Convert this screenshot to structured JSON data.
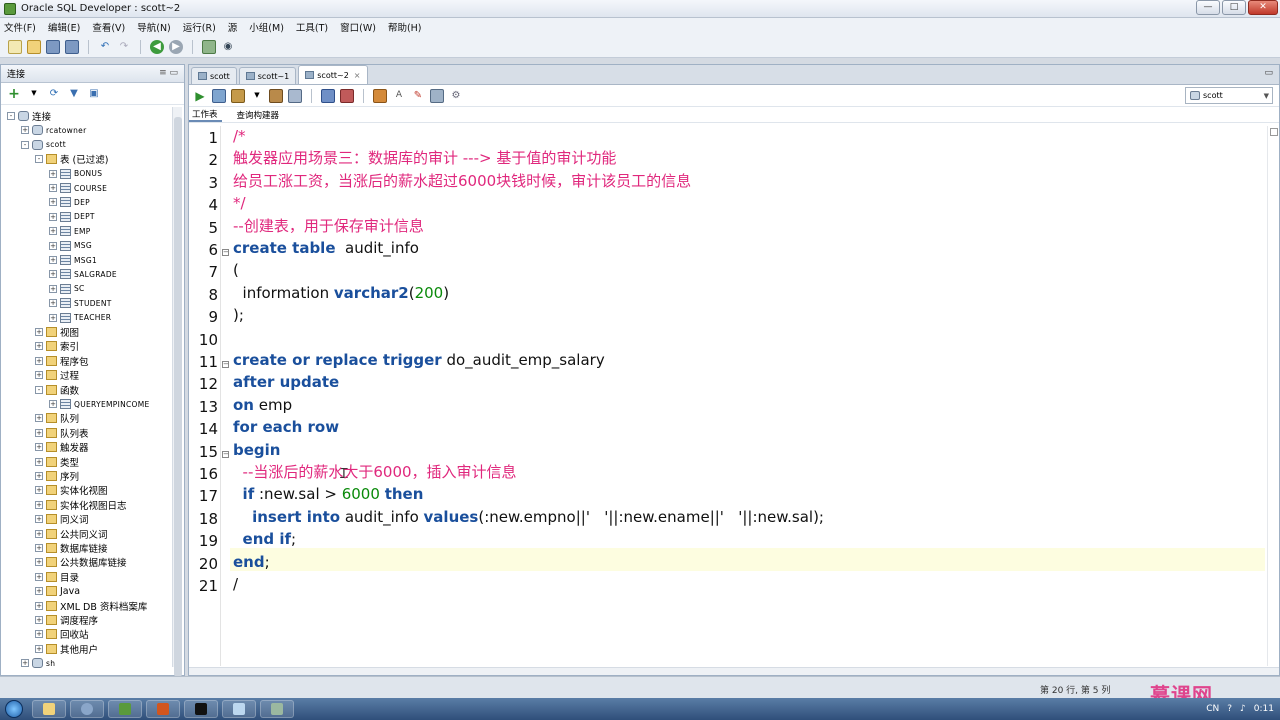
{
  "window": {
    "title": "Oracle SQL Developer : scott~2"
  },
  "menu": [
    "文件(F)",
    "编辑(E)",
    "查看(V)",
    "导航(N)",
    "运行(R)",
    "源",
    "小组(M)",
    "工具(T)",
    "窗口(W)",
    "帮助(H)"
  ],
  "left_panel": {
    "header": "连接",
    "tree": [
      {
        "label": "连接",
        "level": 0,
        "exp": "-",
        "icon": "db"
      },
      {
        "label": "rcatowner",
        "level": 1,
        "exp": "+",
        "icon": "db",
        "tiny": true
      },
      {
        "label": "scott",
        "level": 1,
        "exp": "-",
        "icon": "db",
        "tiny": true
      },
      {
        "label": "表 (已过滤)",
        "level": 2,
        "exp": "-",
        "icon": "folder"
      },
      {
        "label": "BONUS",
        "level": 3,
        "exp": "+",
        "icon": "table",
        "tiny": true
      },
      {
        "label": "COURSE",
        "level": 3,
        "exp": "+",
        "icon": "table",
        "tiny": true
      },
      {
        "label": "DEP",
        "level": 3,
        "exp": "+",
        "icon": "table",
        "tiny": true
      },
      {
        "label": "DEPT",
        "level": 3,
        "exp": "+",
        "icon": "table",
        "tiny": true
      },
      {
        "label": "EMP",
        "level": 3,
        "exp": "+",
        "icon": "table",
        "tiny": true
      },
      {
        "label": "MSG",
        "level": 3,
        "exp": "+",
        "icon": "table",
        "tiny": true
      },
      {
        "label": "MSG1",
        "level": 3,
        "exp": "+",
        "icon": "table",
        "tiny": true
      },
      {
        "label": "SALGRADE",
        "level": 3,
        "exp": "+",
        "icon": "table",
        "tiny": true
      },
      {
        "label": "SC",
        "level": 3,
        "exp": "+",
        "icon": "table",
        "tiny": true
      },
      {
        "label": "STUDENT",
        "level": 3,
        "exp": "+",
        "icon": "table",
        "tiny": true
      },
      {
        "label": "TEACHER",
        "level": 3,
        "exp": "+",
        "icon": "table",
        "tiny": true
      },
      {
        "label": "视图",
        "level": 2,
        "exp": "+",
        "icon": "folder"
      },
      {
        "label": "索引",
        "level": 2,
        "exp": "+",
        "icon": "folder"
      },
      {
        "label": "程序包",
        "level": 2,
        "exp": "+",
        "icon": "folder"
      },
      {
        "label": "过程",
        "level": 2,
        "exp": "+",
        "icon": "folder"
      },
      {
        "label": "函数",
        "level": 2,
        "exp": "-",
        "icon": "folder"
      },
      {
        "label": "QUERYEMPINCOME",
        "level": 3,
        "exp": "+",
        "icon": "table",
        "tiny": true
      },
      {
        "label": "队列",
        "level": 2,
        "exp": "+",
        "icon": "folder"
      },
      {
        "label": "队列表",
        "level": 2,
        "exp": "+",
        "icon": "folder"
      },
      {
        "label": "触发器",
        "level": 2,
        "exp": "+",
        "icon": "folder"
      },
      {
        "label": "类型",
        "level": 2,
        "exp": "+",
        "icon": "folder"
      },
      {
        "label": "序列",
        "level": 2,
        "exp": "+",
        "icon": "folder"
      },
      {
        "label": "实体化视图",
        "level": 2,
        "exp": "+",
        "icon": "folder"
      },
      {
        "label": "实体化视图日志",
        "level": 2,
        "exp": "+",
        "icon": "folder"
      },
      {
        "label": "同义词",
        "level": 2,
        "exp": "+",
        "icon": "folder"
      },
      {
        "label": "公共同义词",
        "level": 2,
        "exp": "+",
        "icon": "folder"
      },
      {
        "label": "数据库链接",
        "level": 2,
        "exp": "+",
        "icon": "folder"
      },
      {
        "label": "公共数据库链接",
        "level": 2,
        "exp": "+",
        "icon": "folder"
      },
      {
        "label": "目录",
        "level": 2,
        "exp": "+",
        "icon": "folder"
      },
      {
        "label": "Java",
        "level": 2,
        "exp": "+",
        "icon": "folder"
      },
      {
        "label": "XML DB 资料档案库",
        "level": 2,
        "exp": "+",
        "icon": "folder"
      },
      {
        "label": "调度程序",
        "level": 2,
        "exp": "+",
        "icon": "folder"
      },
      {
        "label": "回收站",
        "level": 2,
        "exp": "+",
        "icon": "folder"
      },
      {
        "label": "其他用户",
        "level": 2,
        "exp": "+",
        "icon": "folder"
      },
      {
        "label": "sh",
        "level": 1,
        "exp": "+",
        "icon": "db",
        "tiny": true
      }
    ]
  },
  "editor": {
    "tabs": [
      {
        "label": "scott",
        "active": false
      },
      {
        "label": "scott~1",
        "active": false
      },
      {
        "label": "scott~2",
        "active": true
      }
    ],
    "connection": "scott",
    "subtabs": [
      "工作表",
      "查询构建器"
    ],
    "lines": [
      [
        {
          "t": "/*",
          "c": "cmt"
        }
      ],
      [
        {
          "t": "触发器应用场景三：数据库的审计 ---> 基于值的审计功能",
          "c": "cmt"
        }
      ],
      [
        {
          "t": "给员工涨工资，当涨后的薪水超过6000块钱时候，审计该员工的信息",
          "c": "cmt"
        }
      ],
      [
        {
          "t": "*/",
          "c": "cmt"
        }
      ],
      [
        {
          "t": "--创建表，用于保存审计信息",
          "c": "cmt"
        }
      ],
      [
        {
          "t": "create table",
          "c": "kw"
        },
        {
          "t": "  audit_info",
          "c": "tx"
        }
      ],
      [
        {
          "t": "(",
          "c": "tx"
        }
      ],
      [
        {
          "t": "  information ",
          "c": "tx"
        },
        {
          "t": "varchar2",
          "c": "kw"
        },
        {
          "t": "(",
          "c": "tx"
        },
        {
          "t": "200",
          "c": "num"
        },
        {
          "t": ")",
          "c": "tx"
        }
      ],
      [
        {
          "t": ");",
          "c": "tx"
        }
      ],
      [],
      [
        {
          "t": "create or replace trigger",
          "c": "kw"
        },
        {
          "t": " do_audit_emp_salary",
          "c": "tx"
        }
      ],
      [
        {
          "t": "after update",
          "c": "kw"
        }
      ],
      [
        {
          "t": "on",
          "c": "kw"
        },
        {
          "t": " emp",
          "c": "tx"
        }
      ],
      [
        {
          "t": "for each row",
          "c": "kw"
        }
      ],
      [
        {
          "t": "begin",
          "c": "kw"
        }
      ],
      [
        {
          "t": "  --当涨后的薪水大于6000，插入审计信息",
          "c": "cmt"
        }
      ],
      [
        {
          "t": "  ",
          "c": "tx"
        },
        {
          "t": "if",
          "c": "kw"
        },
        {
          "t": " :new.sal > ",
          "c": "tx"
        },
        {
          "t": "6000",
          "c": "num"
        },
        {
          "t": " ",
          "c": "tx"
        },
        {
          "t": "then",
          "c": "kw"
        }
      ],
      [
        {
          "t": "    ",
          "c": "tx"
        },
        {
          "t": "insert into",
          "c": "kw"
        },
        {
          "t": " audit_info ",
          "c": "tx"
        },
        {
          "t": "values",
          "c": "kw"
        },
        {
          "t": "(:new.empno||'   '||:new.ename||'   '||:new.sal);",
          "c": "tx"
        }
      ],
      [
        {
          "t": "  ",
          "c": "tx"
        },
        {
          "t": "end if",
          "c": "kw"
        },
        {
          "t": ";",
          "c": "tx"
        }
      ],
      [
        {
          "t": "end",
          "c": "kw"
        },
        {
          "t": ";",
          "c": "tx"
        }
      ],
      [
        {
          "t": "/",
          "c": "tx"
        }
      ]
    ],
    "fold_lines": [
      6,
      11,
      15
    ],
    "current_line": 20
  },
  "status": {
    "position": "第 20 行, 第 5 列"
  },
  "taskbar": {
    "tray_lang": "CN",
    "time": "0:11"
  },
  "watermark": "慕课网"
}
